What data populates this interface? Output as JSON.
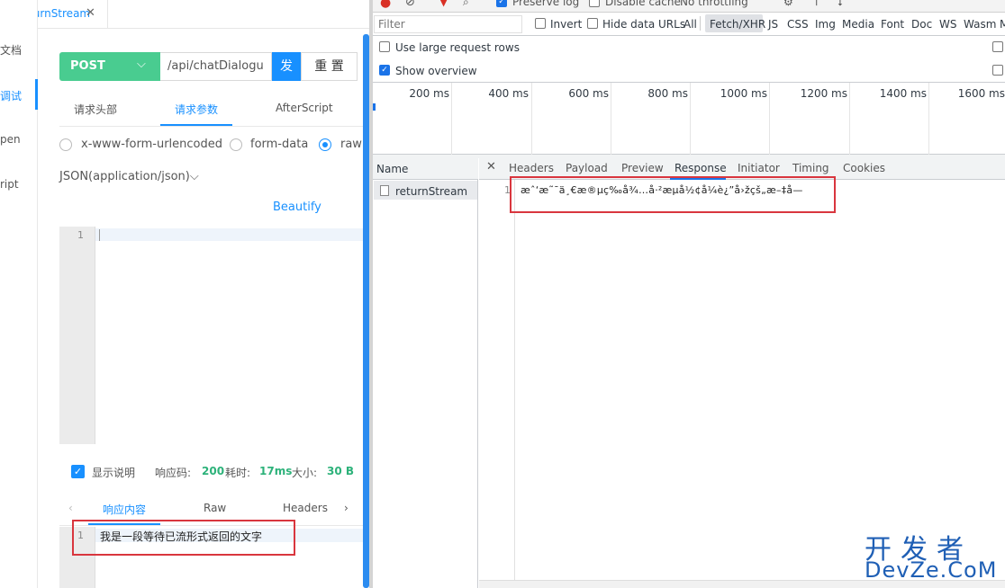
{
  "left": {
    "tab_title": "returnStream",
    "sidenav": [
      "文档",
      "调试",
      "pen",
      "ript"
    ],
    "method": "POST",
    "url": "/api/chatDialogu",
    "send_label": "发",
    "reset_label": "重 置",
    "subtabs": [
      "请求头部",
      "请求参数",
      "AfterScript"
    ],
    "body_types": [
      "x-www-form-urlencoded",
      "form-data",
      "raw"
    ],
    "content_type": "JSON(application/json)",
    "beautify": "Beautify",
    "editor_line": "1",
    "show_desc": "显示说明",
    "status_label": "响应码:",
    "status_value": "200",
    "time_label": "耗时:",
    "time_value": "17ms",
    "size_label": "大小:",
    "size_value": "30 B",
    "resp_tabs": [
      "响应内容",
      "Raw",
      "Headers"
    ],
    "resp_line": "1",
    "resp_text": "我是一段等待已流形式返回的文字"
  },
  "devtools": {
    "toolbar": [
      "Preserve log",
      "Disable cache",
      "No throttling"
    ],
    "filter_placeholder": "Filter",
    "invert": "Invert",
    "hide_data": "Hide data URLs",
    "all": "All",
    "filters": [
      "Fetch/XHR",
      "JS",
      "CSS",
      "Img",
      "Media",
      "Font",
      "Doc",
      "WS",
      "Wasm",
      "M"
    ],
    "large_rows": "Use large request rows",
    "show_overview": "Show overview",
    "timeline": [
      "200 ms",
      "400 ms",
      "600 ms",
      "800 ms",
      "1000 ms",
      "1200 ms",
      "1400 ms",
      "1600 ms"
    ],
    "name_header": "Name",
    "request_name": "returnStream",
    "detail_tabs": [
      "Headers",
      "Payload",
      "Preview",
      "Response",
      "Initiator",
      "Timing",
      "Cookies"
    ],
    "response_line": "1",
    "response_text": "æˆ‘æ˜¯ä¸€æ®µç­‰å¾…å·²æµå½¢å¼è¿”å›žçš„æ–‡å­—"
  },
  "watermark": {
    "top": "开发者",
    "bottom": "DevZe.CoM"
  },
  "colors": {
    "accent": "#1890ff",
    "post": "#49cc90",
    "highlight": "#d9363e",
    "success": "#2db27a"
  }
}
